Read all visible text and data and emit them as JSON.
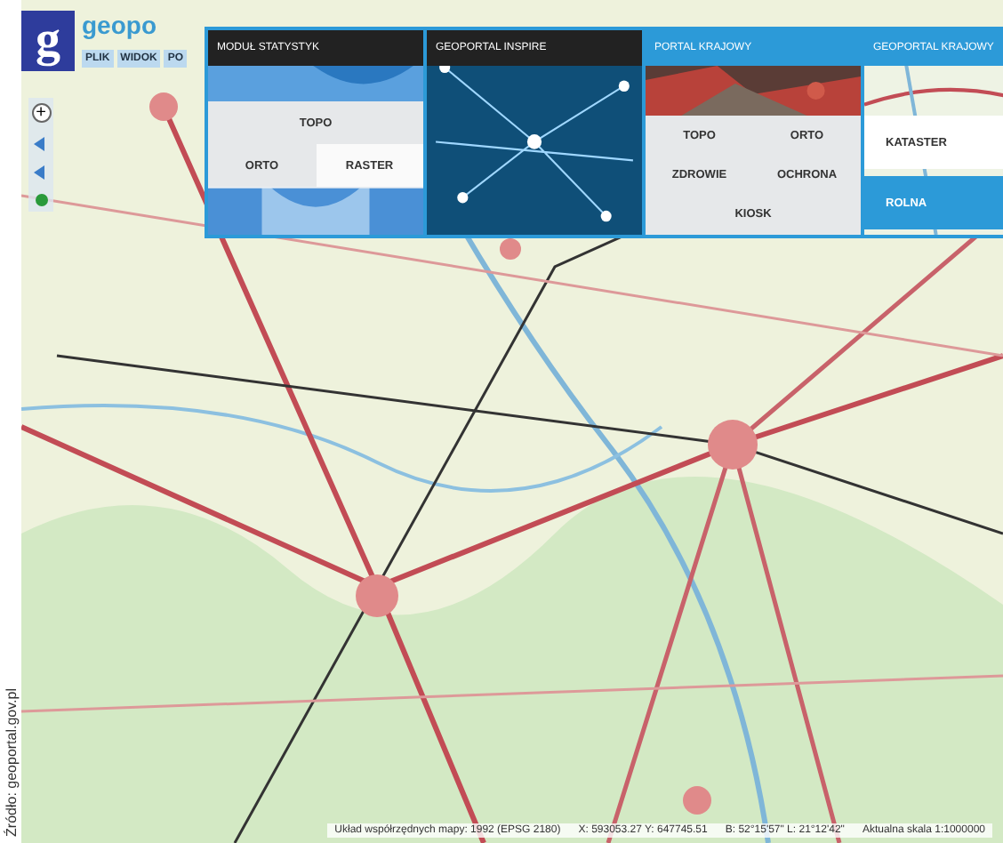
{
  "caption": "Źródło: geoportal.gov.pl",
  "app": {
    "logo": "g",
    "brand": "geopo",
    "menu": [
      "PLIK",
      "WIDOK",
      "PO"
    ]
  },
  "toolbar": {
    "zoom_in": "+"
  },
  "panels": [
    {
      "kind": "overlay",
      "title": "MODUŁ STATYSTYK",
      "buttons": [
        {
          "label": "TOPO",
          "selected": false
        },
        {
          "label": "ORTO",
          "selected": false
        },
        {
          "label": "RASTER",
          "selected": true
        }
      ]
    },
    {
      "title": "GEOPORTAL INSPIRE"
    },
    {
      "kind": "tiles",
      "title": "PORTAL KRAJOWY",
      "buttons": [
        {
          "label": "TOPO",
          "selected": false
        },
        {
          "label": "ORTO",
          "selected": false
        },
        {
          "label": "ZDROWIE",
          "selected": false
        },
        {
          "label": "OCHRONA",
          "selected": false
        },
        {
          "label": "KIOSK",
          "selected": false
        }
      ]
    },
    {
      "kind": "list",
      "title": "GEOPORTAL KRAJOWY",
      "buttons": [
        {
          "label": "KATASTER",
          "selected": false
        },
        {
          "label": "ROLNA",
          "selected": true
        }
      ]
    }
  ],
  "status_bar": [
    "Układ współrzędnych mapy: 1992 (EPSG 2180)",
    "X: 593053.27 Y: 647745.51",
    "B: 52°15'57\" L: 21°12'42\"",
    "Aktualna skala 1:1000000"
  ]
}
